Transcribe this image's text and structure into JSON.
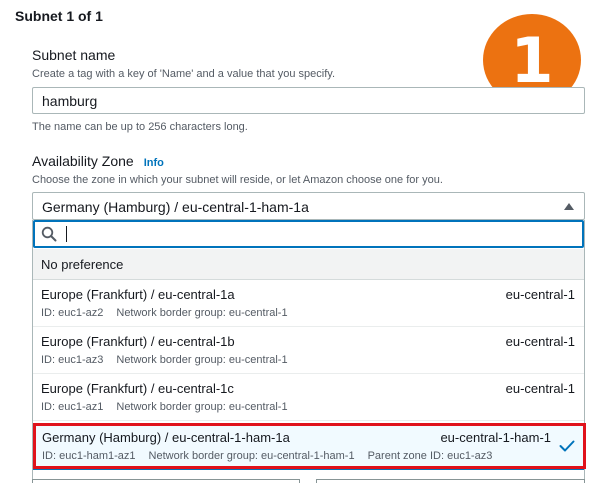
{
  "section": {
    "title": "Subnet 1 of 1",
    "step_number": "1"
  },
  "subnet_name": {
    "label": "Subnet name",
    "description": "Create a tag with a key of 'Name' and a value that you specify.",
    "value": "hamburg",
    "hint": "The name can be up to 256 characters long."
  },
  "az": {
    "label": "Availability Zone",
    "info": "Info",
    "description": "Choose the zone in which your subnet will reside, or let Amazon choose one for you.",
    "selected": "Germany (Hamburg) / eu-central-1-ham-1a",
    "search_value": "",
    "no_preference": "No preference",
    "options": [
      {
        "title": "Europe (Frankfurt) / eu-central-1a",
        "region": "eu-central-1",
        "id": "ID: euc1-az2",
        "border": "Network border group: eu-central-1",
        "parent": ""
      },
      {
        "title": "Europe (Frankfurt) / eu-central-1b",
        "region": "eu-central-1",
        "id": "ID: euc1-az3",
        "border": "Network border group: eu-central-1",
        "parent": ""
      },
      {
        "title": "Europe (Frankfurt) / eu-central-1c",
        "region": "eu-central-1",
        "id": "ID: euc1-az1",
        "border": "Network border group: eu-central-1",
        "parent": ""
      },
      {
        "title": "Germany (Hamburg) / eu-central-1-ham-1a",
        "region": "eu-central-1-ham-1",
        "id": "ID: euc1-ham1-az1",
        "border": "Network border group: eu-central-1-ham-1",
        "parent": "Parent zone ID: euc1-az3"
      }
    ]
  },
  "colors": {
    "accent": "#0073bb",
    "badge": "#ec7211",
    "highlight": "#e0121b"
  }
}
